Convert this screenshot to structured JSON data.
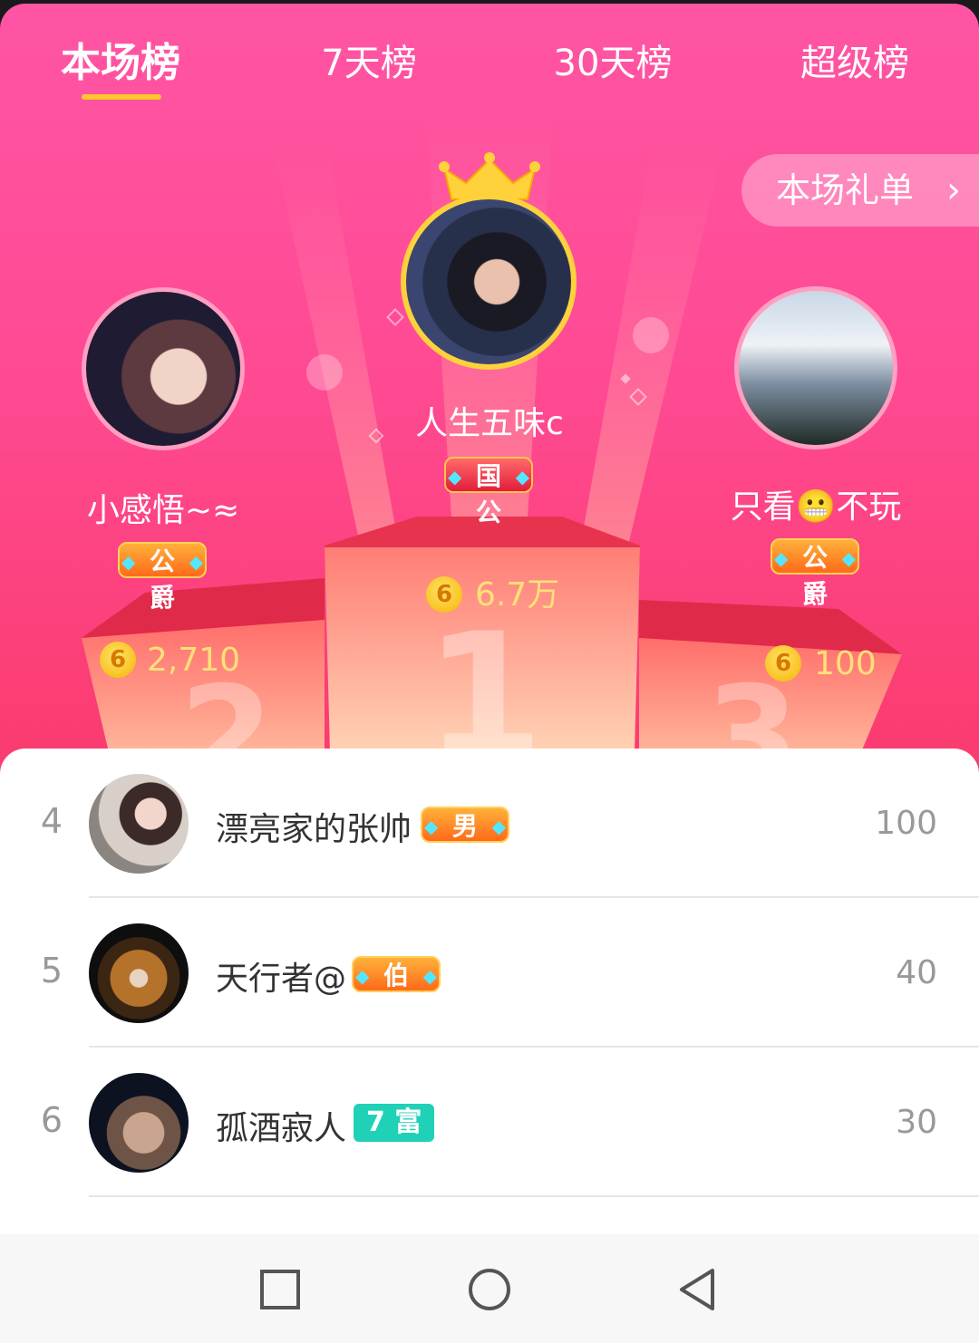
{
  "tabs": [
    {
      "label": "本场榜",
      "active": true
    },
    {
      "label": "7天榜",
      "active": false
    },
    {
      "label": "30天榜",
      "active": false
    },
    {
      "label": "超级榜",
      "active": false
    }
  ],
  "gift_list_button": "本场礼单",
  "podium": {
    "first": {
      "name": "人生五味c",
      "badge": "国公",
      "score": "6.7万",
      "place": "1"
    },
    "second": {
      "name": "小感悟~≈",
      "badge": "公爵",
      "score": "2,710",
      "place": "2"
    },
    "third": {
      "name": "只看😬不玩",
      "badge": "公爵",
      "score": "100",
      "place": "3"
    }
  },
  "coin_glyph": "6",
  "list": [
    {
      "rank": "4",
      "name": "漂亮家的张帅",
      "badge": "男爵",
      "score": "100"
    },
    {
      "rank": "5",
      "name": "天行者@",
      "badge": "伯爵",
      "score": "40"
    },
    {
      "rank": "6",
      "name": "孤酒寂人",
      "level": "7 富",
      "score": "30"
    }
  ],
  "colors": {
    "background_top": "#ff55a4",
    "background_bottom": "#f53a5e",
    "tab_indicator": "#ffc72c",
    "score_highlight": "#ffe07a",
    "level_badge": "#1fd1b7"
  },
  "icons": [
    "crown-icon",
    "coin-icon",
    "chevron-right-icon",
    "nav-recents-icon",
    "nav-home-icon",
    "nav-back-icon"
  ]
}
